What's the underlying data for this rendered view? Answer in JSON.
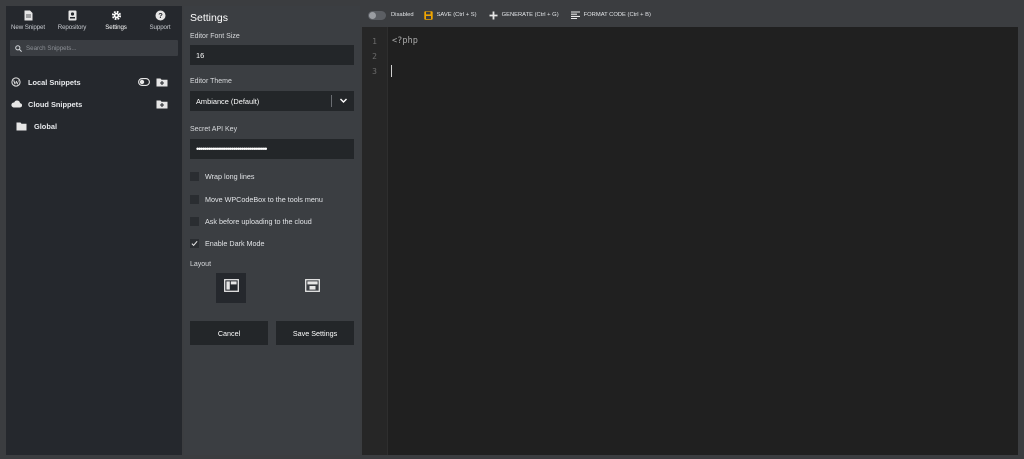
{
  "nav": {
    "items": [
      {
        "label": "New Snippet",
        "icon": "file-icon"
      },
      {
        "label": "Repository",
        "icon": "repository-icon"
      },
      {
        "label": "Settings",
        "icon": "gear-icon",
        "active": true
      },
      {
        "label": "Support",
        "icon": "help-icon"
      }
    ]
  },
  "search": {
    "placeholder": "Search Snippets...",
    "value": ""
  },
  "tree": {
    "local": {
      "label": "Local Snippets",
      "icon": "wordpress-icon"
    },
    "cloud": {
      "label": "Cloud Snippets",
      "icon": "cloud-icon"
    },
    "folders": [
      {
        "label": "Global",
        "icon": "folder-icon"
      }
    ]
  },
  "settings": {
    "title": "Settings",
    "font_size_label": "Editor Font Size",
    "font_size_value": "16",
    "theme_label": "Editor Theme",
    "theme_value": "Ambiance (Default)",
    "api_key_label": "Secret API Key",
    "api_key_value": "••••••••••••••••••••••••••••••••••••",
    "checkboxes": [
      {
        "label": "Wrap long lines",
        "checked": false
      },
      {
        "label": "Move WPCodeBox to the tools menu",
        "checked": false
      },
      {
        "label": "Ask before uploading to the cloud",
        "checked": false
      },
      {
        "label": "Enable Dark Mode",
        "checked": true
      }
    ],
    "layout_label": "Layout",
    "cancel_label": "Cancel",
    "save_label": "Save Settings"
  },
  "toolbar": {
    "status_label": "Disabled",
    "save_label": "SAVE (Ctrl + S)",
    "generate_label": "GENERATE (Ctrl + G)",
    "format_label": "FORMAT CODE (Ctrl + B)"
  },
  "editor": {
    "line_numbers": [
      "1",
      "2",
      "3"
    ],
    "lines": [
      "<?php",
      "",
      ""
    ]
  },
  "colors": {
    "accent_save": "#f0a500",
    "panel_bg": "#3b3e42",
    "sidebar_bg": "#25282d",
    "editor_bg": "#202020"
  }
}
